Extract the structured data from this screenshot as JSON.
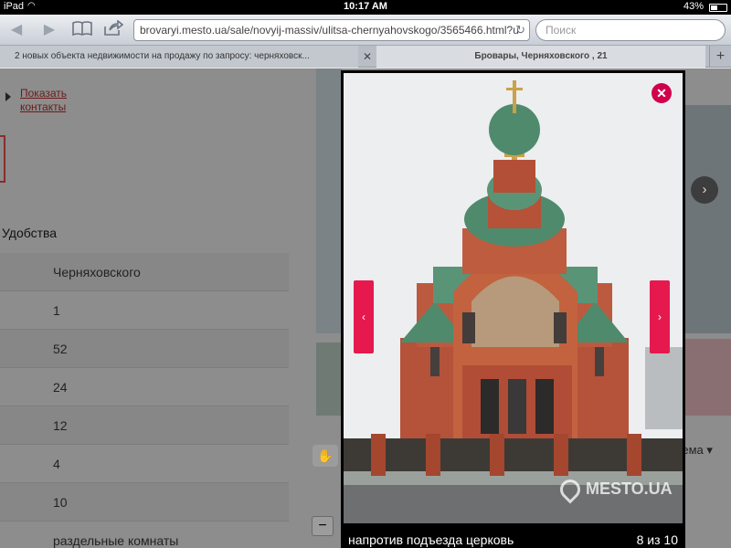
{
  "status_bar": {
    "device": "iPad",
    "time": "10:17 AM",
    "battery": "43%",
    "battery_level": 0.43
  },
  "toolbar": {
    "url": "brovaryi.mesto.ua/sale/novyij-massiv/ulitsa-chernyahovskogo/3565466.html?u",
    "search_placeholder": "Поиск"
  },
  "tabs": [
    {
      "label": "2 новых объекта недвижимости на продажу по запросу: черняховск..."
    },
    {
      "label": "Бровары, Черняховского , 21"
    }
  ],
  "page": {
    "contacts_link": "Показать контакты",
    "section_title": "Удобства",
    "rows": [
      "Черняховского",
      "1",
      "52",
      "24",
      "12",
      "4",
      "10",
      "раздельные комнаты"
    ],
    "map_select": "хема ▾"
  },
  "lightbox": {
    "caption": "напротив подъезда церковь",
    "counter": "8 из 10",
    "watermark": "MESTO.UA"
  }
}
